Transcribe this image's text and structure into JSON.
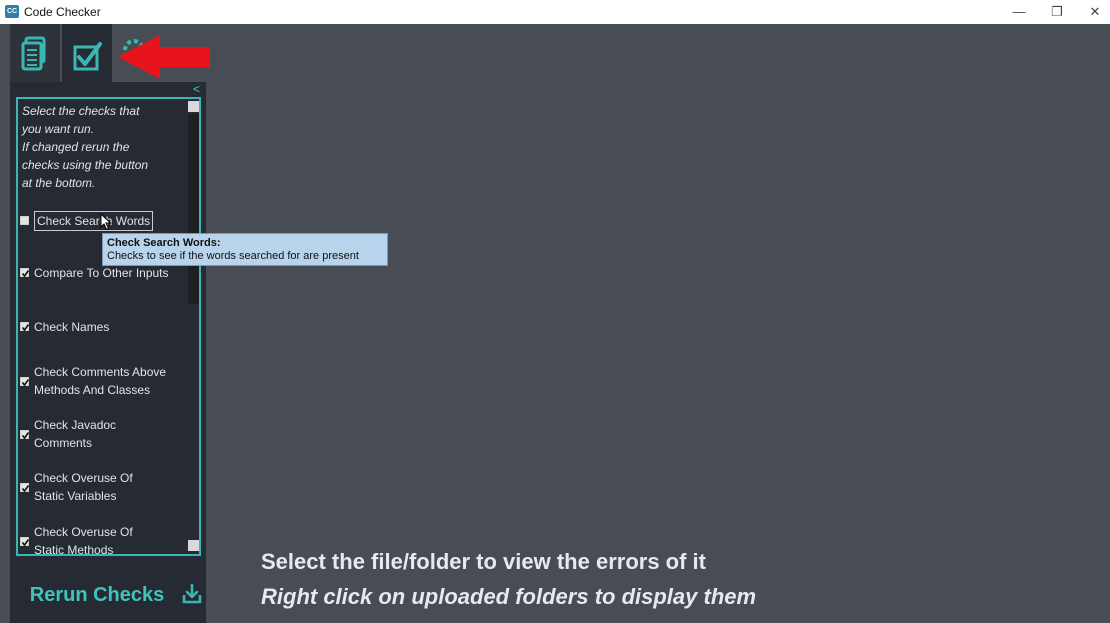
{
  "window": {
    "title": "Code Checker",
    "app_icon_text": "CC",
    "controls": {
      "minimize": "—",
      "restore": "❐",
      "close": "✕"
    }
  },
  "sidebar": {
    "tabs": [
      {
        "name": "files",
        "icon": "document-icon"
      },
      {
        "name": "checks",
        "icon": "checkbox-icon",
        "active": true
      },
      {
        "name": "settings",
        "icon": "gear-icon"
      }
    ],
    "collapse_label": "<",
    "intro_text": "  Select the checks that\nyou want run.\n  If changed rerun the\nchecks using the button\nat the bottom.",
    "checks": [
      {
        "label": "Check Search Words",
        "checked": false,
        "focused": true
      },
      {
        "label": "Compare To Other Inputs",
        "checked": true
      },
      {
        "label": "Check Names",
        "checked": true
      },
      {
        "label": "Check Comments Above\nMethods And Classes",
        "checked": true
      },
      {
        "label": "Check Javadoc\nComments",
        "checked": true
      },
      {
        "label": "Check Overuse Of\nStatic Variables",
        "checked": true
      },
      {
        "label": "Check Overuse Of\nStatic Methods",
        "checked": true
      }
    ],
    "rerun_label": "Rerun Checks"
  },
  "tooltip": {
    "title": "Check Search Words:",
    "body": "Checks to see if the words searched for are present"
  },
  "main": {
    "message": "Select the file/folder to view the errors of it",
    "hint": "Right click on uploaded folders to display them"
  },
  "colors": {
    "accent": "#3ab7b2",
    "background": "#474c55",
    "sidebar": "#262b33",
    "arrow": "#e8141c"
  }
}
